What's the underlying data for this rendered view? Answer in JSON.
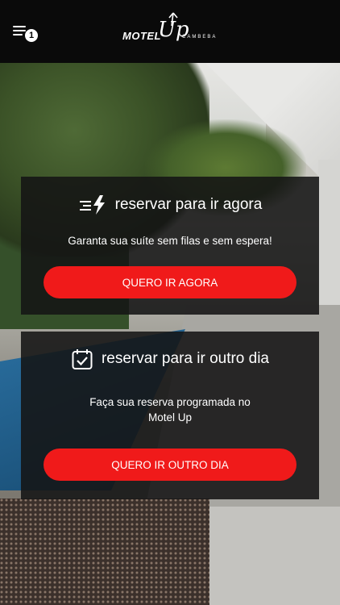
{
  "header": {
    "menu_badge": "1",
    "logo": {
      "motel": "MOTEL",
      "up": "Up",
      "location": "CAMBEBA"
    }
  },
  "cards": [
    {
      "title": "reservar para ir agora",
      "icon": "fast-lightning-icon",
      "description": "Garanta sua suíte sem filas e sem espera!",
      "button_label": "QUERO IR AGORA"
    },
    {
      "title": "reservar para ir outro dia",
      "icon": "calendar-check-icon",
      "description_line1": "Faça sua reserva programada no",
      "description_line2": "Motel Up",
      "button_label": "QUERO IR OUTRO DIA"
    }
  ],
  "colors": {
    "accent": "#f01a1a",
    "header_bg": "#0a0a0a",
    "card_bg": "rgba(20,20,20,0.88)"
  }
}
